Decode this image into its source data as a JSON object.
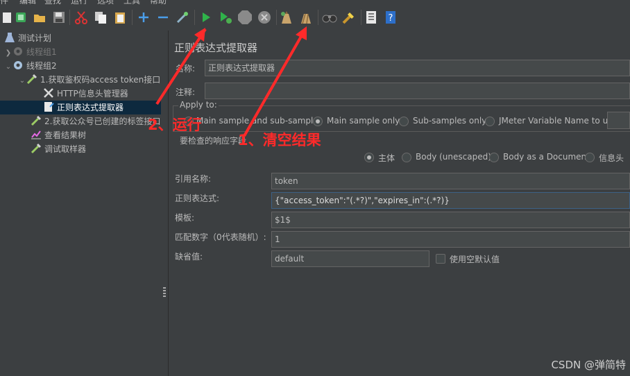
{
  "menu": [
    "件",
    "编辑",
    "查找",
    "运行",
    "选项",
    "工具",
    "帮助"
  ],
  "toolbar": {
    "icons": [
      "new-icon",
      "templates-icon",
      "open-icon",
      "save-icon",
      "cut-icon",
      "copy-icon",
      "paste-icon",
      "expand-icon",
      "collapse-icon",
      "toggle-icon",
      "start-icon",
      "start-no-pause-icon",
      "stop-icon",
      "shutdown-icon",
      "clear-icon",
      "clear-all-icon",
      "search-icon",
      "reset-search-icon",
      "function-helper-icon",
      "help-icon"
    ]
  },
  "tree": {
    "items": [
      {
        "label": "测试计划"
      },
      {
        "label": "线程组1"
      },
      {
        "label": "线程组2"
      },
      {
        "label": "1.获取鉴权码access token接口"
      },
      {
        "label": "HTTP信息头管理器"
      },
      {
        "label": "正则表达式提取器"
      },
      {
        "label": "2.获取公众号已创建的标签接口"
      },
      {
        "label": "查看结果树"
      },
      {
        "label": "调试取样器"
      }
    ]
  },
  "panel": {
    "title": "正则表达式提取器",
    "name_label": "名称:",
    "name_value": "正则表达式提取器",
    "comment_label": "注释:",
    "comment_value": "",
    "apply_to": {
      "legend": "Apply to:",
      "options": [
        "Main sample and sub-samples",
        "Main sample only",
        "Sub-samples only",
        "JMeter Variable Name to use"
      ],
      "selected": "Main sample only"
    },
    "field_to_check": {
      "legend": "要检查的响应字段",
      "options": [
        "主体",
        "Body (unescaped)",
        "Body as a Document",
        "信息头"
      ],
      "selected": "主体"
    },
    "ref_name_label": "引用名称:",
    "ref_name_value": "token",
    "regex_label": "正则表达式:",
    "regex_value": "{\"access_token\":\"(.*?)\",\"expires_in\":(.*?)}",
    "template_label": "模板:",
    "template_value": "$1$",
    "match_no_label": "匹配数字（0代表随机）:",
    "match_no_value": "1",
    "default_label": "缺省值:",
    "default_value": "default",
    "use_empty_default_label": "使用空默认值",
    "use_empty_default_checked": false
  },
  "annotations": {
    "run": "2、运行",
    "clear": "1、清空结果"
  },
  "watermark": "CSDN @弹简特",
  "colors": {
    "accent_red": "#ff2a2a",
    "selection": "#0d293e",
    "background": "#3c3f41"
  }
}
